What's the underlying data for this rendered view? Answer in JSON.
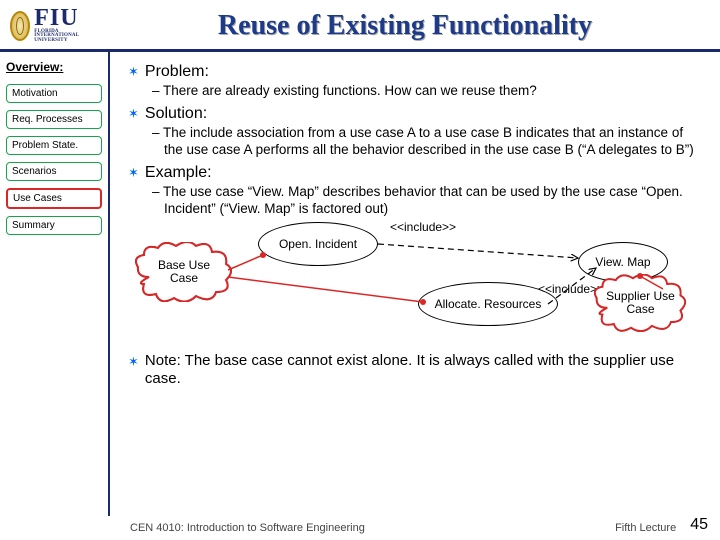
{
  "header": {
    "logo_text": "FIU",
    "logo_sub": "FLORIDA INTERNATIONAL UNIVERSITY",
    "title": "Reuse of Existing Functionality"
  },
  "sidebar": {
    "heading": "Overview:",
    "items": [
      {
        "label": "Motivation"
      },
      {
        "label": "Req. Processes"
      },
      {
        "label": "Problem State."
      },
      {
        "label": "Scenarios"
      },
      {
        "label": "Use Cases"
      },
      {
        "label": "Summary"
      }
    ],
    "active_index": 4
  },
  "content": {
    "b1": "Problem:",
    "b1a": "– There are already existing functions. How can we reuse them?",
    "b2": "Solution:",
    "b2a": "– The include association from a use case A to a use case B indicates that an instance of the use case A performs all the behavior described in the use case B (“A delegates to B”)",
    "b3": "Example:",
    "b3a": "– The use case “View. Map” describes behavior that can be used by the use case “Open. Incident” (“View. Map”  is factored out)",
    "diagram": {
      "include1": "<<include>>",
      "include2": "<<include>>",
      "ellipse1": "Open. Incident",
      "ellipse2": "Allocate. Resources",
      "ellipse3": "View. Map",
      "cloud1": "Base Use Case",
      "cloud2": "Supplier Use Case"
    },
    "b4": "Note: The base case cannot exist alone. It is always called with the supplier use case."
  },
  "footer": {
    "left": "CEN 4010: Introduction to Software Engineering",
    "right": "Fifth Lecture",
    "page": "45"
  }
}
